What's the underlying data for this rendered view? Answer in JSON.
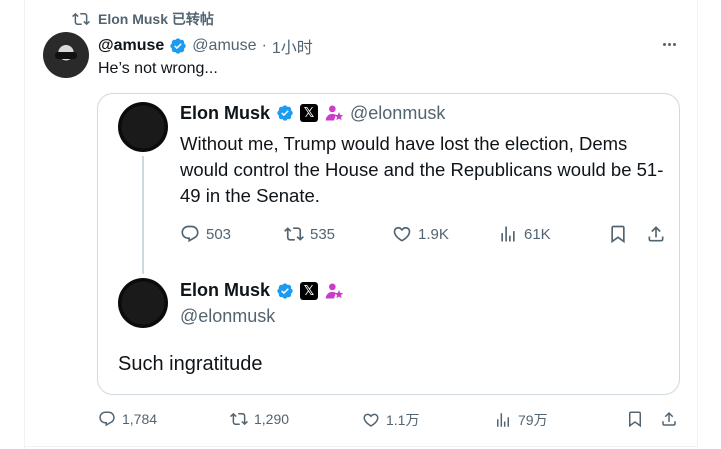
{
  "repost": {
    "label": "Elon Musk 已转帖"
  },
  "tweet": {
    "name": "@amuse",
    "handle": "@amuse",
    "separator": "·",
    "time": "1小时",
    "text": "He’s not wrong...",
    "stats": {
      "replies": "1,784",
      "reposts": "1,290",
      "likes": "1.1万",
      "views": "79万"
    }
  },
  "quote": {
    "name": "Elon Musk",
    "handle": "@elonmusk",
    "x_badge": "𝕏",
    "text": "Without me, Trump would have lost the election, Dems would control the House and the Republicans would be 51-49 in the Senate.",
    "stats": {
      "replies": "503",
      "reposts": "535",
      "likes": "1.9K",
      "views": "61K"
    }
  },
  "quote_reply": {
    "name": "Elon Musk",
    "handle": "@elonmusk",
    "x_badge": "𝕏",
    "text": "Such ingratitude"
  },
  "colors": {
    "verified": "#1d9bf0",
    "muted": "#536471",
    "border": "#cfd9de",
    "affiliate": "#c93ec9"
  },
  "icons": [
    "repost-icon",
    "verified-badge-icon",
    "more-icon",
    "x-logo-icon",
    "affiliate-icon",
    "reply-icon",
    "like-icon",
    "views-icon",
    "bookmark-icon",
    "share-icon"
  ]
}
